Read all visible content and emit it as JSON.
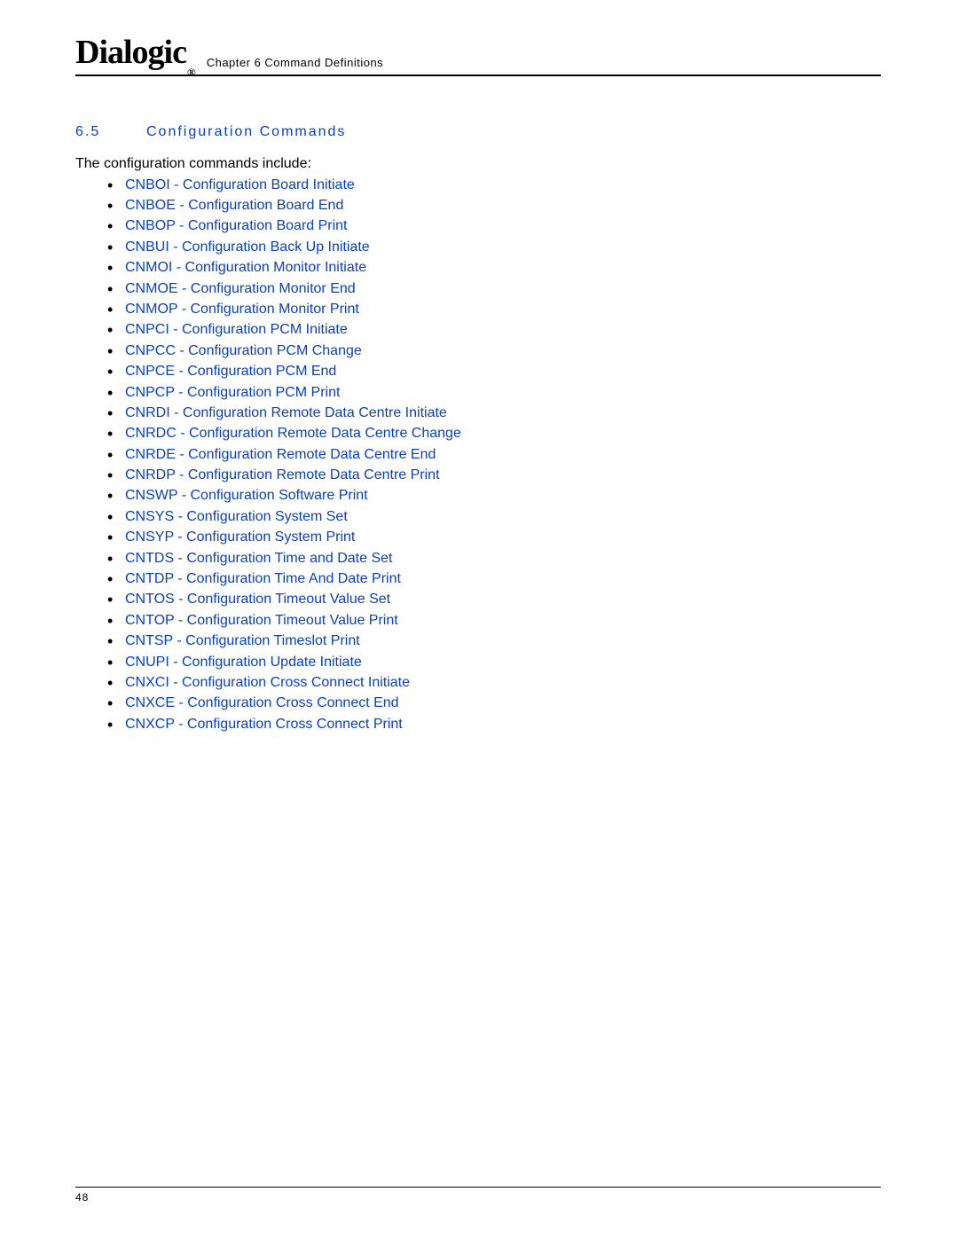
{
  "header": {
    "logo_text": "Dialogic",
    "logo_reg": "®",
    "chapter": "Chapter 6 Command Definitions"
  },
  "section": {
    "number": "6.5",
    "title": "Configuration Commands"
  },
  "intro": "The configuration commands include:",
  "commands": [
    "CNBOI - Configuration Board Initiate",
    "CNBOE - Configuration Board End",
    "CNBOP - Configuration Board Print",
    "CNBUI - Configuration Back Up Initiate",
    "CNMOI - Configuration Monitor Initiate",
    "CNMOE - Configuration Monitor End",
    "CNMOP - Configuration Monitor Print",
    "CNPCI - Configuration PCM Initiate",
    "CNPCC - Configuration PCM Change",
    "CNPCE - Configuration PCM End",
    "CNPCP - Configuration PCM Print",
    "CNRDI - Configuration Remote Data Centre Initiate",
    "CNRDC - Configuration Remote Data Centre Change",
    "CNRDE - Configuration Remote Data Centre End",
    "CNRDP - Configuration Remote Data Centre Print",
    "CNSWP - Configuration Software Print",
    "CNSYS - Configuration System Set",
    "CNSYP - Configuration System Print",
    "CNTDS - Configuration Time and Date Set",
    "CNTDP - Configuration Time And Date Print",
    "CNTOS - Configuration Timeout Value Set",
    "CNTOP - Configuration Timeout Value Print",
    "CNTSP - Configuration Timeslot Print",
    "CNUPI - Configuration Update Initiate",
    "CNXCI - Configuration Cross Connect Initiate",
    "CNXCE - Configuration Cross Connect End",
    "CNXCP - Configuration Cross Connect Print"
  ],
  "footer": {
    "page_number": "48"
  }
}
